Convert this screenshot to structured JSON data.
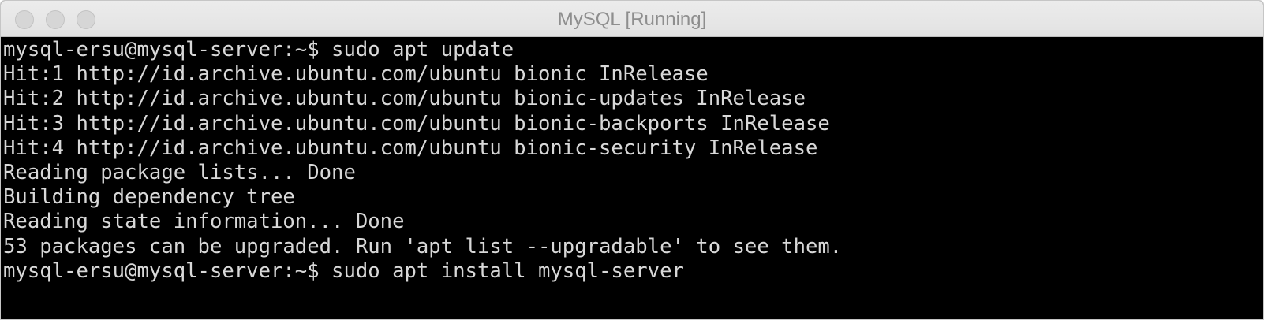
{
  "window": {
    "title": "MySQL [Running]",
    "controls": [
      "close",
      "minimize",
      "zoom"
    ]
  },
  "terminal": {
    "lines": [
      "mysql-ersu@mysql-server:~$ sudo apt update",
      "Hit:1 http://id.archive.ubuntu.com/ubuntu bionic InRelease",
      "Hit:2 http://id.archive.ubuntu.com/ubuntu bionic-updates InRelease",
      "Hit:3 http://id.archive.ubuntu.com/ubuntu bionic-backports InRelease",
      "Hit:4 http://id.archive.ubuntu.com/ubuntu bionic-security InRelease",
      "Reading package lists... Done",
      "Building dependency tree",
      "Reading state information... Done",
      "53 packages can be upgraded. Run 'apt list --upgradable' to see them.",
      "mysql-ersu@mysql-server:~$ sudo apt install mysql-server"
    ]
  },
  "colors": {
    "terminal_background": "#000000",
    "terminal_text": "#d8d8d8",
    "titlebar": "#e6e6e6",
    "title_text": "#8e8e8e"
  }
}
